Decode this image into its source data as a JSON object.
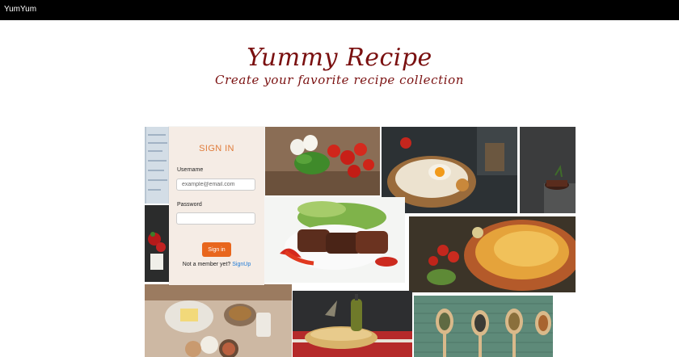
{
  "navbar": {
    "brand": "YumYum"
  },
  "hero": {
    "title": "Yummy Recipe",
    "subtitle": "Create your favorite recipe collection"
  },
  "login": {
    "title": "SIGN IN",
    "username_label": "Username",
    "username_placeholder": "example@email.com",
    "username_value": "",
    "password_label": "Password",
    "password_value": "",
    "signin_label": "Sign in",
    "member_prompt": "Not a member yet?",
    "signup_link": "SignUp"
  },
  "colors": {
    "navbar": "#000000",
    "hero_text": "#7a1010",
    "login_bg": "#f5ece5",
    "login_title": "#e07b3a",
    "button": "#e8661d",
    "link": "#1f7ad6"
  }
}
